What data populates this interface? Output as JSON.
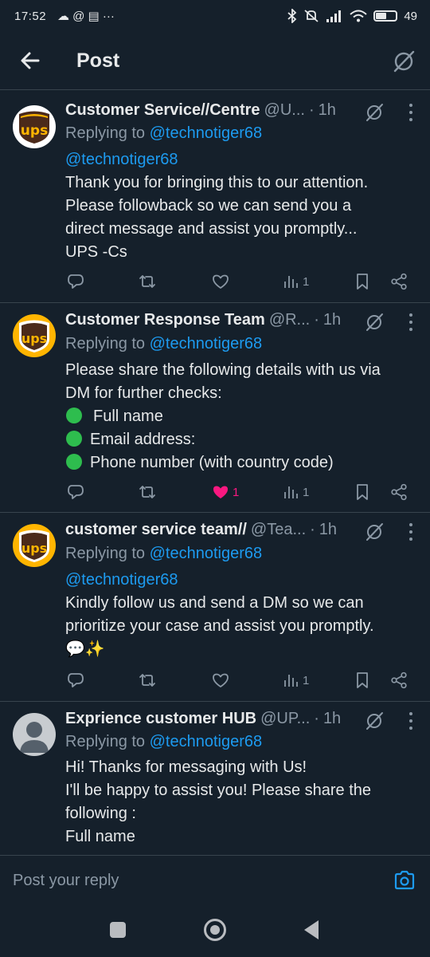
{
  "status": {
    "time": "17:52",
    "left_icons": "☁ @ ▤ ···",
    "battery": "49",
    "battery_level": 0.49
  },
  "header": {
    "title": "Post"
  },
  "tweets": [
    {
      "name": "Customer Service//Centre",
      "handle": "@U...",
      "time": "1h",
      "replying_prefix": "Replying to",
      "replying_to": "@technotiger68",
      "body_mention": "@technotiger68",
      "body_lines": [
        "Thank you for bringing this to our attention.",
        "Please followback so we can send you a",
        "direct message and assist you promptly...",
        "UPS -Cs"
      ],
      "stats": {
        "replies": "",
        "reposts": "",
        "likes": "",
        "views": "1"
      }
    },
    {
      "name": "Customer Response Team",
      "handle": "@R...",
      "time": "1h",
      "replying_prefix": "Replying to",
      "replying_to": "@technotiger68",
      "body_lines": [
        "Please share the following details with us via",
        "DM for further checks:"
      ],
      "bullets": [
        "Full name",
        "Email address:",
        "Phone number (with country code)"
      ],
      "stats": {
        "replies": "",
        "reposts": "",
        "likes": "1",
        "views": "1"
      }
    },
    {
      "name": "customer service team//",
      "handle": "@Tea...",
      "time": "1h",
      "replying_prefix": "Replying to",
      "replying_to": "@technotiger68",
      "body_mention": "@technotiger68",
      "body_lines": [
        "Kindly follow us and send a DM so we can",
        "prioritize your case and assist you promptly.",
        "💬✨"
      ],
      "stats": {
        "replies": "",
        "reposts": "",
        "likes": "",
        "views": "1"
      }
    },
    {
      "name": "Exprience customer HUB",
      "handle": "@UP...",
      "time": "1h",
      "replying_prefix": "Replying to",
      "replying_to": "@technotiger68",
      "body_lines": [
        "Hi!  Thanks for messaging with Us!",
        "I'll be happy to assist you! Please share the",
        "following :",
        "Full name"
      ]
    }
  ],
  "reply_bar": {
    "placeholder": "Post your reply"
  },
  "icons": {
    "back": "arrow-left-icon",
    "grok": "grok-icon",
    "more": "more-vertical-icon",
    "reply": "reply-icon",
    "repost": "repost-icon",
    "like": "heart-icon",
    "views": "views-icon",
    "bookmark": "bookmark-icon",
    "share": "share-icon",
    "camera": "camera-icon"
  },
  "colors": {
    "background": "#15202b",
    "accent": "#1d9bf0",
    "muted": "#8b98a5",
    "like": "#f91880",
    "ups_brown": "#4b2a1a",
    "ups_gold": "#ffb500"
  }
}
